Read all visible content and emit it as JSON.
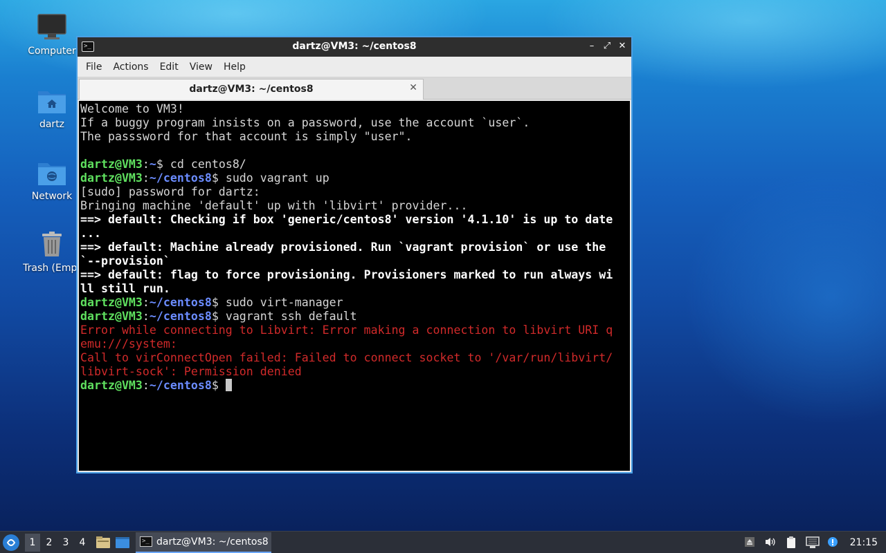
{
  "desktop": {
    "icons": [
      {
        "label": "Computer",
        "icon": "monitor-icon"
      },
      {
        "label": "dartz",
        "icon": "home-folder-icon"
      },
      {
        "label": "Network",
        "icon": "network-folder-icon"
      },
      {
        "label": "Trash (Empt",
        "icon": "trash-icon"
      }
    ]
  },
  "window": {
    "title": "dartz@VM3: ~/centos8",
    "titlebar_icon": ">_",
    "buttons": {
      "minimize": "–",
      "maximize": "⤢",
      "close": "✕"
    },
    "menu": [
      "File",
      "Actions",
      "Edit",
      "View",
      "Help"
    ],
    "tab": {
      "title": "dartz@VM3: ~/centos8",
      "close": "✕"
    }
  },
  "terminal": {
    "lines": [
      [
        {
          "t": "Welcome to VM3!",
          "s": "plain"
        }
      ],
      [
        {
          "t": "If a buggy program insists on a password, use the account `user`.",
          "s": "plain"
        }
      ],
      [
        {
          "t": "The passsword for that account is simply \"user\".",
          "s": "plain"
        }
      ],
      [
        {
          "t": "",
          "s": "plain"
        }
      ],
      [
        {
          "t": "dartz@VM3",
          "s": "user"
        },
        {
          "t": ":",
          "s": "plain"
        },
        {
          "t": "~",
          "s": "path"
        },
        {
          "t": "$ cd centos8/",
          "s": "plain"
        }
      ],
      [
        {
          "t": "dartz@VM3",
          "s": "user"
        },
        {
          "t": ":",
          "s": "plain"
        },
        {
          "t": "~/centos8",
          "s": "path"
        },
        {
          "t": "$ sudo vagrant up",
          "s": "plain"
        }
      ],
      [
        {
          "t": "[sudo] password for dartz:",
          "s": "plain"
        }
      ],
      [
        {
          "t": "Bringing machine 'default' up with 'libvirt' provider...",
          "s": "plain"
        }
      ],
      [
        {
          "t": "==> default: Checking if box 'generic/centos8' version '4.1.10' is up to date",
          "s": "bold"
        }
      ],
      [
        {
          "t": "...",
          "s": "bold"
        }
      ],
      [
        {
          "t": "==> default: Machine already provisioned. Run `vagrant provision` or use the",
          "s": "bold"
        }
      ],
      [
        {
          "t": "`--provision`",
          "s": "bold"
        }
      ],
      [
        {
          "t": "==> default: flag to force provisioning. Provisioners marked to run always wi",
          "s": "bold"
        }
      ],
      [
        {
          "t": "ll still run.",
          "s": "bold"
        }
      ],
      [
        {
          "t": "dartz@VM3",
          "s": "user"
        },
        {
          "t": ":",
          "s": "plain"
        },
        {
          "t": "~/centos8",
          "s": "path"
        },
        {
          "t": "$ sudo virt-manager",
          "s": "plain"
        }
      ],
      [
        {
          "t": "dartz@VM3",
          "s": "user"
        },
        {
          "t": ":",
          "s": "plain"
        },
        {
          "t": "~/centos8",
          "s": "path"
        },
        {
          "t": "$ vagrant ssh default",
          "s": "plain"
        }
      ],
      [
        {
          "t": "Error while connecting to Libvirt: Error making a connection to libvirt URI q",
          "s": "err"
        }
      ],
      [
        {
          "t": "emu:///system:",
          "s": "err"
        }
      ],
      [
        {
          "t": "Call to virConnectOpen failed: Failed to connect socket to '/var/run/libvirt/",
          "s": "err"
        }
      ],
      [
        {
          "t": "libvirt-sock': Permission denied",
          "s": "err"
        }
      ],
      [
        {
          "t": "dartz@VM3",
          "s": "user"
        },
        {
          "t": ":",
          "s": "plain"
        },
        {
          "t": "~/centos8",
          "s": "path"
        },
        {
          "t": "$ ",
          "s": "plain"
        }
      ]
    ]
  },
  "taskbar": {
    "start_icon": "start-menu-icon",
    "workspaces": [
      "1",
      "2",
      "3",
      "4"
    ],
    "active_workspace": "1",
    "task_label": "dartz@VM3: ~/centos8",
    "clock": "21:15"
  },
  "colors": {
    "prompt_user": "#5fe05f",
    "prompt_path": "#6b8cff",
    "error": "#d12a2a",
    "window_border": "#4aa0e6"
  }
}
